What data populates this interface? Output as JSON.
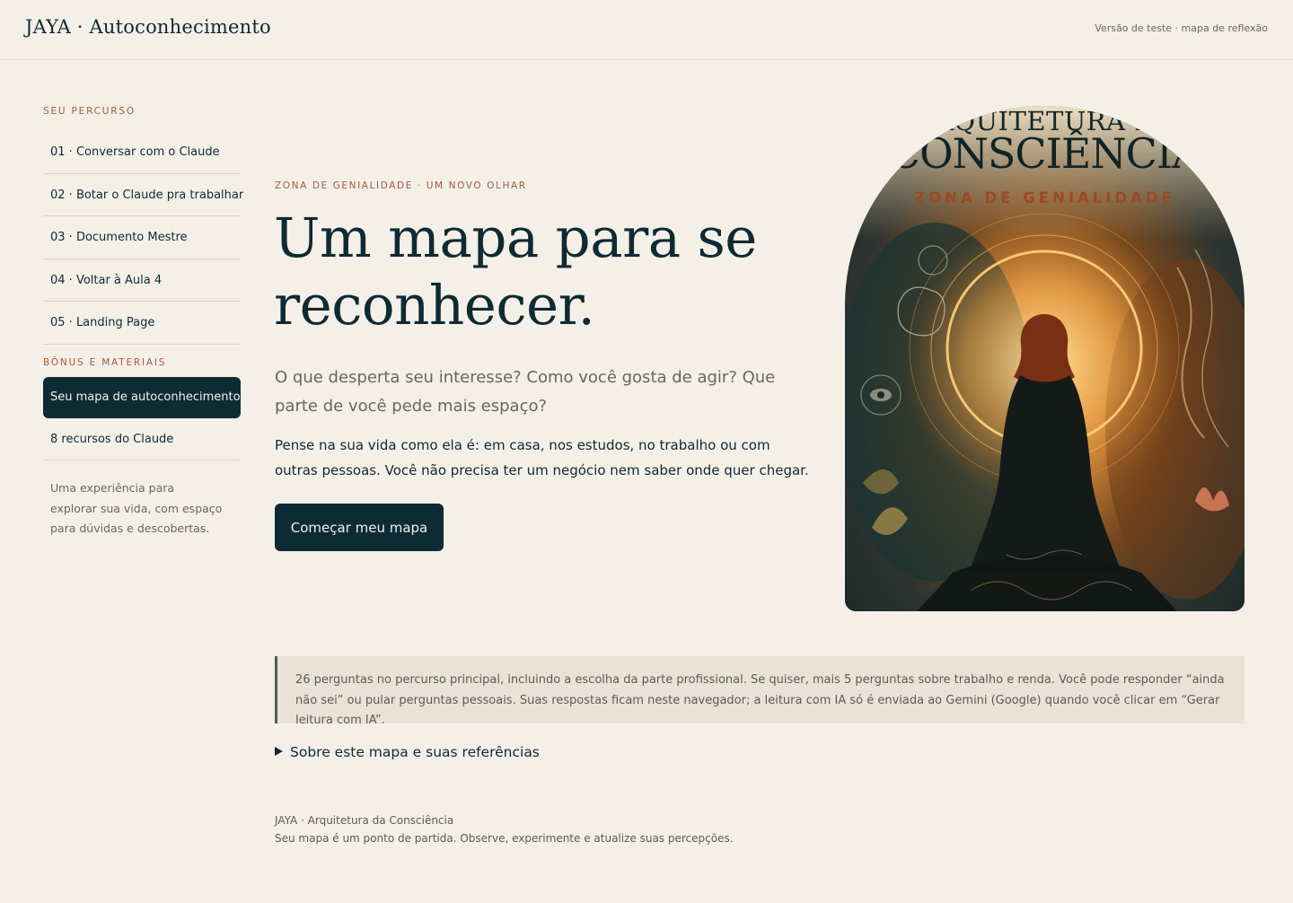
{
  "header": {
    "brand": "JAYA · Autoconhecimento",
    "version_note": "Versão de teste · mapa de reflexão"
  },
  "sidebar": {
    "section_course": "SEU PERCURSO",
    "course_items": [
      {
        "label": "01 · Conversar com o Claude"
      },
      {
        "label": "02 · Botar o Claude pra trabalhar"
      },
      {
        "label": "03 · Documento Mestre"
      },
      {
        "label": "04 · Voltar à Aula 4"
      },
      {
        "label": "05 · Landing Page"
      }
    ],
    "section_bonus": "BÔNUS E MATERIAIS",
    "bonus_items": [
      {
        "label": "Seu mapa de autoconhecimento",
        "active": true
      },
      {
        "label": "8 recursos do Claude",
        "active": false
      }
    ],
    "note": "Uma experiência para explorar sua vida, com espaço para dúvidas e descobertas."
  },
  "main": {
    "eyebrow": "ZONA DE GENIALIDADE · UM NOVO OLHAR",
    "headline": "Um mapa para se reconhecer.",
    "lead": "O que desperta seu interesse? Como você gosta de agir? Que parte de você pede mais espaço?",
    "body": "Pense na sua vida como ela é: em casa, nos estudos, no trabalho ou com outras pessoas. Você não precisa ter um negócio nem saber onde quer chegar.",
    "cta_label": "Começar meu mapa"
  },
  "hero_image": {
    "title_line1": "ARQUITETURA DA",
    "title_line2": "CONSCIÊNCIA",
    "subtitle": "ZONA DE GENIALIDADE",
    "accent_color": "#9a4a24"
  },
  "info_box": {
    "text": "26 perguntas no percurso principal, incluindo a escolha da parte profissional. Se quiser, mais 5 perguntas sobre trabalho e renda. Você pode responder “ainda não sei” ou pular perguntas pessoais. Suas respostas ficam neste navegador; a leitura com IA só é enviada ao Gemini (Google) quando você clicar em “Gerar leitura com IA”."
  },
  "details_label": "Sobre este mapa e suas referências",
  "footer": {
    "line1": "JAYA · Arquitetura da Consciência",
    "line2": "Seu mapa é um ponto de partida. Observe, experimente e atualize suas percepções."
  },
  "colors": {
    "background": "#f4f0e8",
    "primary": "#0d2b35",
    "accent": "#a25a3a",
    "muted_text": "#6a665d",
    "info_background": "#e8e3d7",
    "info_border": "#4d6151"
  }
}
